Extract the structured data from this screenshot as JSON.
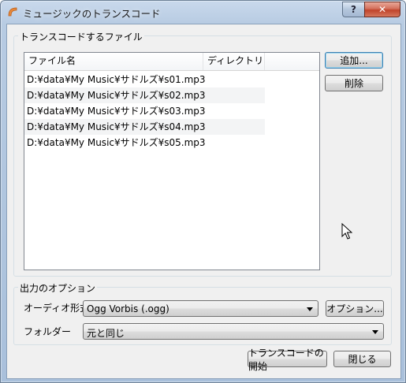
{
  "window": {
    "title": "ミュージックのトランスコード",
    "help_label": "?",
    "close_label": "✕",
    "icon": "app-icon"
  },
  "files_group": {
    "label": "トランスコードするファイル",
    "columns": [
      "ファイル名",
      "ディレクトリ"
    ],
    "files": [
      "D:¥data¥My Music¥サドルズ¥s01.mp3",
      "D:¥data¥My Music¥サドルズ¥s02.mp3",
      "D:¥data¥My Music¥サドルズ¥s03.mp3",
      "D:¥data¥My Music¥サドルズ¥s04.mp3",
      "D:¥data¥My Music¥サドルズ¥s05.mp3"
    ],
    "add_label": "追加...",
    "remove_label": "削除"
  },
  "output_group": {
    "label": "出力のオプション",
    "format_label": "オーディオ形式",
    "format_value": "Ogg Vorbis (.ogg)",
    "options_label": "オプション...",
    "folder_label": "フォルダー",
    "folder_value": "元と同じ"
  },
  "footer": {
    "start_label": "トランスコードの開始",
    "close_label": "閉じる"
  }
}
